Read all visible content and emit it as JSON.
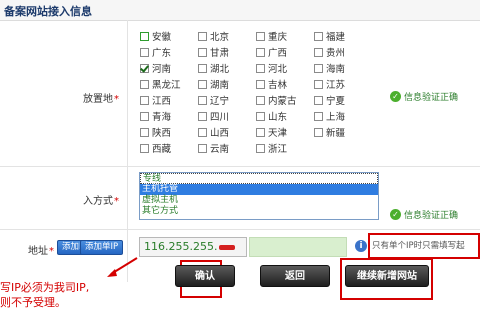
{
  "header": {
    "title": "备案网站接入信息"
  },
  "location": {
    "label": "放置地",
    "required_mark": "*",
    "provinces": [
      {
        "name": "安徽",
        "checked": false,
        "green": true
      },
      {
        "name": "北京",
        "checked": false
      },
      {
        "name": "重庆",
        "checked": false
      },
      {
        "name": "福建",
        "checked": false
      },
      {
        "name": "广东",
        "checked": false
      },
      {
        "name": "甘肃",
        "checked": false
      },
      {
        "name": "广西",
        "checked": false
      },
      {
        "name": "贵州",
        "checked": false
      },
      {
        "name": "河南",
        "checked": true
      },
      {
        "name": "湖北",
        "checked": false
      },
      {
        "name": "河北",
        "checked": false
      },
      {
        "name": "海南",
        "checked": false
      },
      {
        "name": "黑龙江",
        "checked": false
      },
      {
        "name": "湖南",
        "checked": false
      },
      {
        "name": "吉林",
        "checked": false
      },
      {
        "name": "江苏",
        "checked": false
      },
      {
        "name": "江西",
        "checked": false
      },
      {
        "name": "辽宁",
        "checked": false
      },
      {
        "name": "内蒙古",
        "checked": false
      },
      {
        "name": "宁夏",
        "checked": false
      },
      {
        "name": "青海",
        "checked": false
      },
      {
        "name": "四川",
        "checked": false
      },
      {
        "name": "山东",
        "checked": false
      },
      {
        "name": "上海",
        "checked": false
      },
      {
        "name": "陕西",
        "checked": false
      },
      {
        "name": "山西",
        "checked": false
      },
      {
        "name": "天津",
        "checked": false
      },
      {
        "name": "新疆",
        "checked": false
      },
      {
        "name": "西藏",
        "checked": false
      },
      {
        "name": "云南",
        "checked": false
      },
      {
        "name": "浙江",
        "checked": false
      }
    ],
    "verify_text": "信息验证正确"
  },
  "access": {
    "label": "入方式",
    "required_mark": "*",
    "options": [
      {
        "label": "专线",
        "selected": false
      },
      {
        "label": "主机托管",
        "selected": true
      },
      {
        "label": "虚拟主机",
        "selected": false
      },
      {
        "label": "其它方式",
        "selected": false
      }
    ],
    "verify_text": "信息验证正确"
  },
  "ip": {
    "label": "地址",
    "required_mark": "*",
    "add_ip_button": "添加IP段",
    "add_single_button": "添加单IP",
    "value": "116.255.255.",
    "info_icon_glyph": "i",
    "note": "只有单个IP时只需填写起"
  },
  "warning": {
    "line1": "写IP必须为我司IP,",
    "line2": "则不予受理。"
  },
  "buttons": {
    "confirm": "确认",
    "back": "返回",
    "continue_add": "继续新增网站"
  },
  "colors": {
    "warning_red": "#d40000",
    "verify_green": "#2b7d2b",
    "selected_blue": "#2f7de1"
  }
}
